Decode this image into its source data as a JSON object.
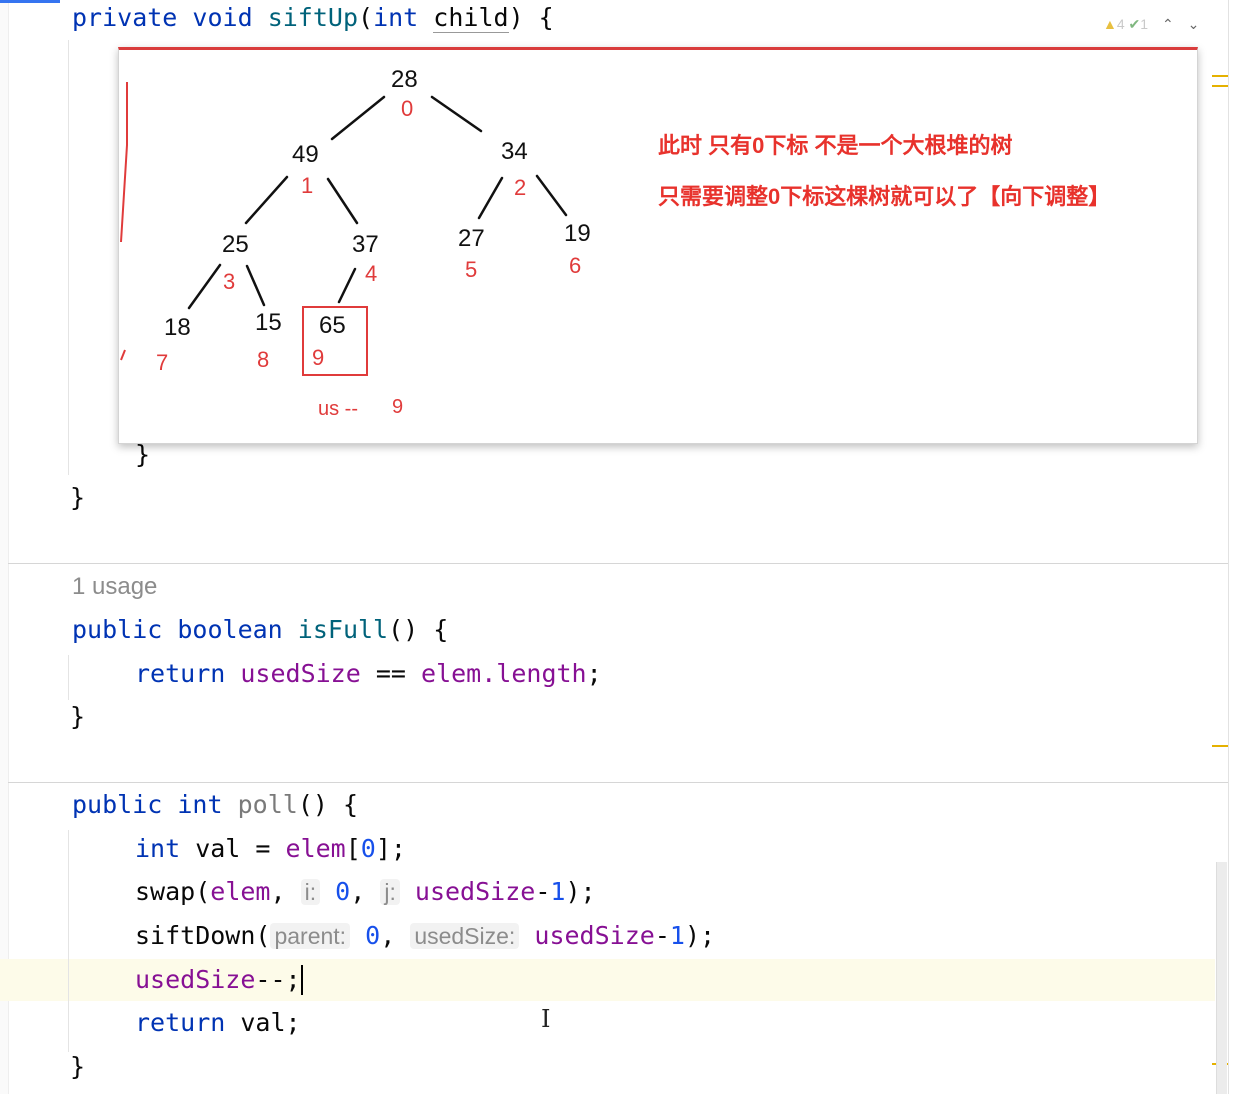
{
  "editor": {
    "top_line": {
      "kw_private": "private",
      "kw_void": "void",
      "method": "siftUp",
      "open": "(",
      "kw_int": "int",
      "param": "child",
      "close": ") {"
    },
    "inspection": {
      "warnings": "4",
      "weak_warnings": "1",
      "up": "⌃",
      "down": "⌄"
    },
    "closing_inner": "}",
    "closing_outer": "}",
    "isfull": {
      "usage": "1 usage",
      "kw_public": "public",
      "kw_boolean": "boolean",
      "name": "isFull",
      "sig_rest": "() {",
      "kw_return": "return",
      "field": "usedSize",
      "op": " == ",
      "elem": "elem",
      "dot_length": ".length",
      "semi": ";",
      "close": "}"
    },
    "poll": {
      "kw_public": "public",
      "kw_int": "int",
      "name": "poll",
      "sig_rest": "() {",
      "l1_int": "int",
      "l1_val": " val = ",
      "l1_elem": "elem",
      "l1_open": "[",
      "l1_zero": "0",
      "l1_close": "];",
      "l2_swap": "swap(",
      "l2_elem": "elem",
      "l2_comma": ", ",
      "l2_hint_i": "i:",
      "l2_zero": "0",
      "l2_comma2": ", ",
      "l2_hint_j": "j:",
      "l2_used": "usedSize",
      "l2_minus": "-",
      "l2_one": "1",
      "l2_end": ");",
      "l3_sift": "siftDown(",
      "l3_hint_parent": "parent:",
      "l3_zero": "0",
      "l3_comma": ", ",
      "l3_hint_used": "usedSize:",
      "l3_used": "usedSize",
      "l3_minus": "-",
      "l3_one": "1",
      "l3_end": ");",
      "l4_used": "usedSize",
      "l4_rest": "--;",
      "l5_return": "return",
      "l5_rest": " val;",
      "close": "}"
    }
  },
  "popup": {
    "nodes": [
      {
        "value": "28",
        "index": "0"
      },
      {
        "value": "49",
        "index": "1"
      },
      {
        "value": "34",
        "index": "2"
      },
      {
        "value": "25",
        "index": "3"
      },
      {
        "value": "37",
        "index": "4"
      },
      {
        "value": "27",
        "index": "5"
      },
      {
        "value": "19",
        "index": "6"
      },
      {
        "value": "18",
        "index": "7"
      },
      {
        "value": "15",
        "index": "8"
      },
      {
        "value": "65",
        "index": "9"
      }
    ],
    "annotation_line1": "此时 只有0下标 不是一个大根堆的树",
    "annotation_line2": "只需要调整0下标这棵树就可以了【向下调整】",
    "us_label": "us --",
    "us_value": "9",
    "colors": {
      "annotation": "#e8322c",
      "index": "#e03b3b",
      "border": "#d93c3c"
    }
  },
  "colors": {
    "keyword": "#0033b3",
    "field": "#871094",
    "number": "#1750eb",
    "hint_bg": "#f2f2f2",
    "current_line": "#fdfbe9"
  }
}
